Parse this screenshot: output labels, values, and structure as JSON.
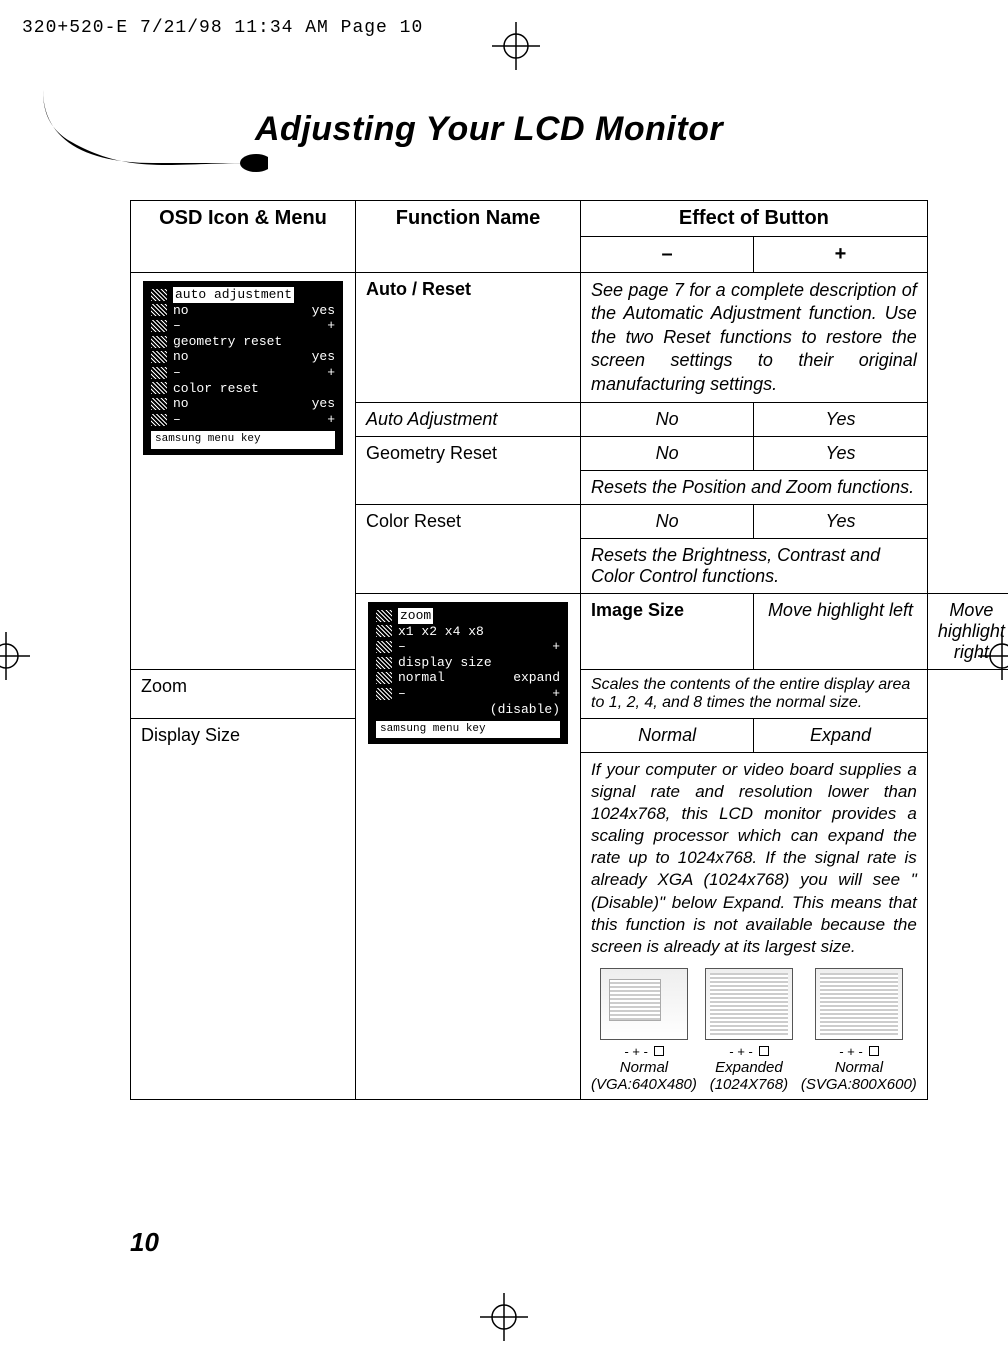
{
  "page_header": "320+520-E  7/21/98 11:34 AM  Page 10",
  "section_title": "Adjusting Your LCD Monitor",
  "page_number": "10",
  "table": {
    "headers": {
      "icon_menu": "OSD Icon & Menu",
      "function": "Function Name",
      "effect": "Effect of Button",
      "minus": "–",
      "plus": "+"
    },
    "auto_reset": {
      "func": "Auto / Reset",
      "desc": "See page 7 for a complete description of the Automatic Adjustment function. Use the two Reset functions to restore the screen settings to their original manufacturing settings."
    },
    "auto_adjustment": {
      "func": "Auto Adjustment",
      "minus": "No",
      "plus": "Yes"
    },
    "geometry_reset": {
      "func": "Geometry Reset",
      "minus": "No",
      "plus": "Yes",
      "note": "Resets the Position and Zoom functions."
    },
    "color_reset": {
      "func": "Color Reset",
      "minus": "No",
      "plus": "Yes",
      "note": "Resets the Brightness, Contrast and Color Control functions."
    },
    "image_size": {
      "func": "Image Size",
      "minus": "Move highlight left",
      "plus": "Move highlight right"
    },
    "zoom": {
      "func": "Zoom",
      "desc": "Scales the contents of the entire display area to 1, 2, 4, and 8 times the normal size."
    },
    "display_size": {
      "func": "Display Size",
      "minus": "Normal",
      "plus": "Expand",
      "desc": "If your computer or video board supplies a signal rate and resolution lower than 1024x768, this LCD monitor provides a scaling processor which can expand the rate up to 1024x768. If the signal rate is already XGA (1024x768) you will see \"(Disable)\" below Expand. This means that this function is not available because the screen is already at its largest size."
    },
    "osd_thumb1": {
      "line1": "auto adjustment",
      "line2a": "no",
      "line2b": "yes",
      "line3a": "–",
      "line3b": "+",
      "line4": "geometry reset",
      "line5a": "no",
      "line5b": "yes",
      "line6a": "–",
      "line6b": "+",
      "line7": "color reset",
      "line8a": "no",
      "line8b": "yes",
      "line9a": "–",
      "line9b": "+",
      "footer": "samsung  menu  key"
    },
    "osd_thumb2": {
      "line1": "zoom",
      "line2": "x1  x2  x4  x8",
      "line3a": "–",
      "line3b": "+",
      "line4": "display size",
      "line5a": "normal",
      "line5b": "expand",
      "line6a": "–",
      "line6b": "+",
      "tag": "(disable)",
      "footer": "samsung  menu  key"
    },
    "triplet": {
      "a_label": "Normal",
      "a_sub": "(VGA:640X480)",
      "b_label": "Expanded",
      "b_sub": "(1024X768)",
      "c_label": "Normal",
      "c_sub": "(SVGA:800X600)",
      "marks": "- + -"
    }
  }
}
